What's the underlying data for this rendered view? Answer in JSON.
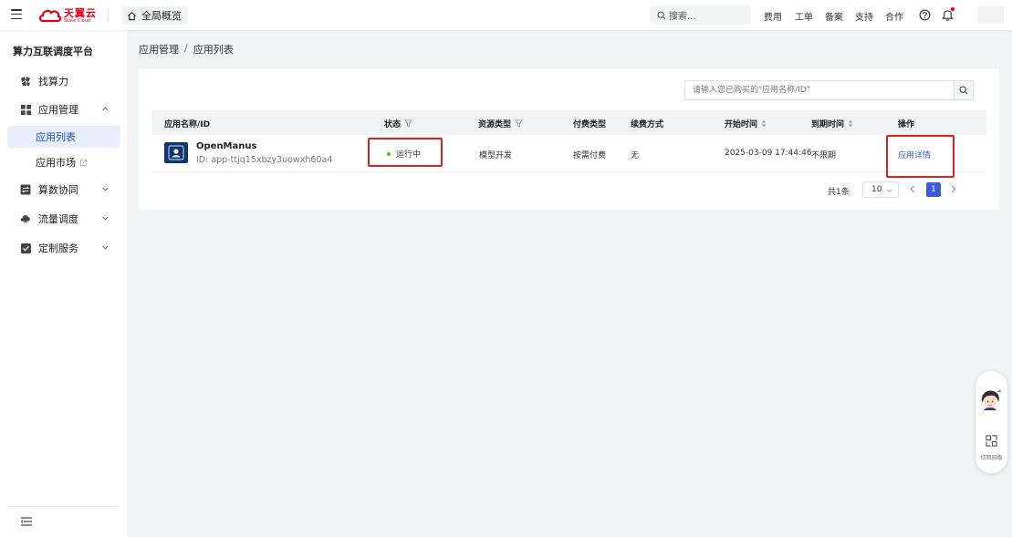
{
  "topbar": {
    "brand_cn": "天翼云",
    "brand_en": "State Cloud",
    "overview_label": "全局概览",
    "search_placeholder": "搜索...",
    "nav": [
      "费用",
      "工单",
      "备案",
      "支持",
      "合作"
    ]
  },
  "sidebar": {
    "platform_title": "算力互联调度平台",
    "items": [
      {
        "label": "找算力",
        "icon": "compute-icon"
      },
      {
        "label": "应用管理",
        "icon": "grid-icon",
        "expanded": true
      },
      {
        "label": "算数协同",
        "icon": "sync-icon"
      },
      {
        "label": "流量调度",
        "icon": "cloud-icon"
      },
      {
        "label": "定制服务",
        "icon": "checkbox-icon"
      }
    ],
    "sub_items": [
      {
        "label": "应用列表",
        "active": true
      },
      {
        "label": "应用市场",
        "external": true
      }
    ]
  },
  "breadcrumb": {
    "parent": "应用管理",
    "separator": "/",
    "current": "应用列表"
  },
  "search": {
    "placeholder": "请输入您已购买的\"应用名称/ID\""
  },
  "table": {
    "headers": {
      "name": "应用名称/ID",
      "status": "状态",
      "resource": "资源类型",
      "pay": "付费类型",
      "renew": "续费方式",
      "start": "开始时间",
      "end": "到期时间",
      "action": "操作"
    },
    "rows": [
      {
        "name": "OpenManus",
        "id": "ID: app-ttjq15xbzy3uowxh60a4",
        "status": "运行中",
        "status_color": "#52c41a",
        "resource": "模型开发",
        "pay": "按需付费",
        "renew": "无",
        "start": "2025-03-09 17:44:46",
        "end": "不限期",
        "action": "应用详情"
      }
    ]
  },
  "pagination": {
    "total": "共1条",
    "page_size": "10",
    "current_page": "1"
  },
  "float_widget": {
    "label": "切回旧版"
  },
  "colors": {
    "accent": "#3b5bdb",
    "brand": "#e60012",
    "highlight_box": "#e02020"
  }
}
